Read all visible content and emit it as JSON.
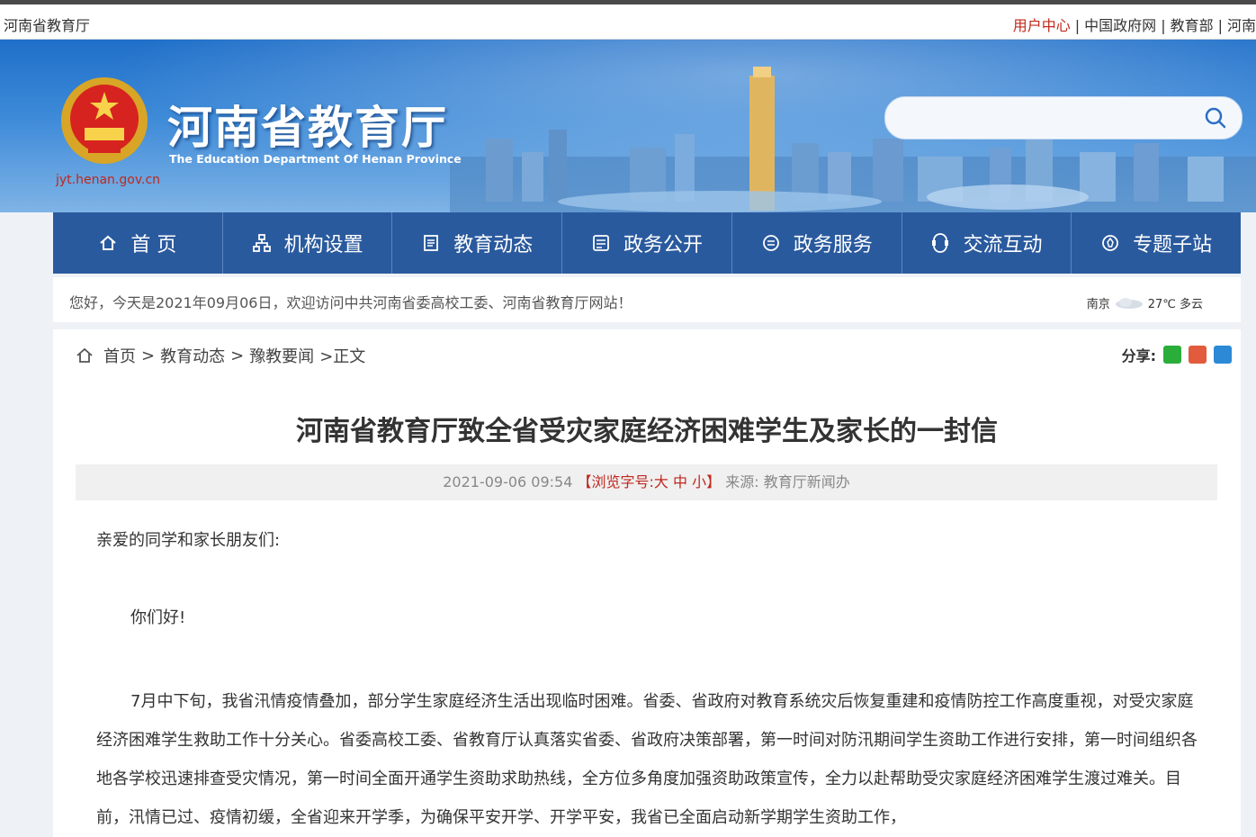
{
  "topbar": {
    "site_name": "河南省教育厅",
    "links": [
      "用户中心",
      "中国政府网",
      "教育部",
      "河南"
    ]
  },
  "banner": {
    "title_cn": "河南省教育厅",
    "title_en": "The Education Department Of Henan Province",
    "domain": "jyt.henan.gov.cn",
    "search_placeholder": ""
  },
  "nav": [
    {
      "label": "首 页",
      "icon": "home-icon"
    },
    {
      "label": "机构设置",
      "icon": "org-chart-icon"
    },
    {
      "label": "教育动态",
      "icon": "news-icon"
    },
    {
      "label": "政务公开",
      "icon": "document-icon"
    },
    {
      "label": "政务服务",
      "icon": "government-service-icon"
    },
    {
      "label": "交流互动",
      "icon": "interaction-icon"
    },
    {
      "label": "专题子站",
      "icon": "topic-site-icon"
    }
  ],
  "greeting": {
    "message": "您好，今天是2021年09月06日，欢迎访问中共河南省委高校工委、河南省教育厅网站！",
    "weather_city": "南京",
    "weather_temp": "27℃ 多云"
  },
  "breadcrumb": [
    "首页",
    ">",
    "教育动态",
    ">",
    "豫教要闻",
    ">正文"
  ],
  "share_label": "分享:",
  "article": {
    "title": "河南省教育厅致全省受灾家庭经济困难学生及家长的一封信",
    "date": "2021-09-06 09:54",
    "font_size_prefix": "【浏览字号:",
    "font_large": "大",
    "font_medium": "中",
    "font_small": "小",
    "font_size_suffix": "】",
    "source": "来源: 教育厅新闻办",
    "salutation": "亲爱的同学和家长朋友们:",
    "hello": "你们好!",
    "paragraph": "7月中下旬，我省汛情疫情叠加，部分学生家庭经济生活出现临时困难。省委、省政府对教育系统灾后恢复重建和疫情防控工作高度重视，对受灾家庭经济困难学生救助工作十分关心。省委高校工委、省教育厅认真落实省委、省政府决策部署，第一时间对防汛期间学生资助工作进行安排，第一时间组织各地各学校迅速排查受灾情况，第一时间全面开通学生资助求助热线，全方位多角度加强资助政策宣传，全力以赴帮助受灾家庭经济困难学生渡过难关。目前，汛情已过、疫情初缓，全省迎来开学季，为确保平安开学、开学平安，我省已全面启动新学期学生资助工作，"
  },
  "colors": {
    "nav_bg": "#2a5a9e",
    "accent_red": "#c0281e",
    "banner_blue": "#1f6fc9"
  }
}
